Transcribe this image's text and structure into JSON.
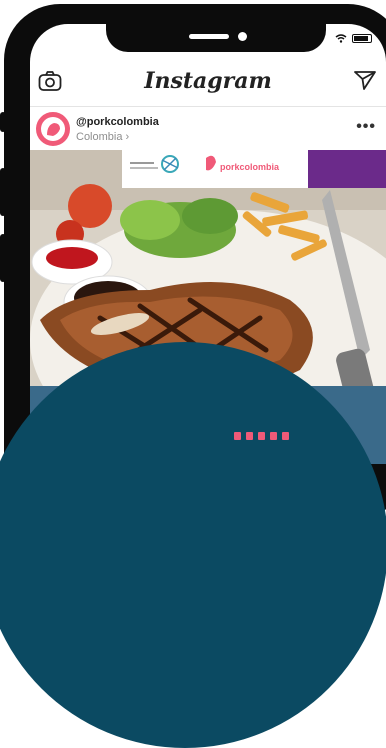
{
  "app": {
    "title": "Instagram"
  },
  "post": {
    "username": "@porkcolombia",
    "location": "Colombia",
    "location_chevron": "›",
    "more_label": "•••"
  },
  "banner": {
    "brand_text": "porkcolombia"
  },
  "colors": {
    "accent": "#f05a78",
    "teal": "#0b4a62",
    "purple": "#6b2a8a"
  },
  "icons": [
    "camera-icon",
    "send-icon",
    "wifi-icon",
    "battery-icon",
    "more-icon"
  ]
}
